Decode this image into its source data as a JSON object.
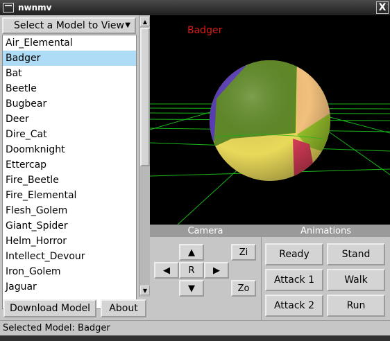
{
  "window": {
    "title": "nwnmv",
    "close_symbol": "X"
  },
  "left": {
    "select_label": "Select a Model to View",
    "models": [
      "Air_Elemental",
      "Badger",
      "Bat",
      "Beetle",
      "Bugbear",
      "Deer",
      "Dire_Cat",
      "Doomknight",
      "Ettercap",
      "Fire_Beetle",
      "Fire_Elemental",
      "Flesh_Golem",
      "Giant_Spider",
      "Helm_Horror",
      "Intellect_Devour",
      "Iron_Golem",
      "Jaguar"
    ],
    "selected_index": 1,
    "download_label": "Download Model",
    "about_label": "About"
  },
  "viewport": {
    "model_name": "Badger",
    "label_color": "#e01818",
    "grid_color": "#19b519"
  },
  "camera": {
    "header": "Camera",
    "up": "▲",
    "left": "◀",
    "reset": "R",
    "right": "▶",
    "down": "▼",
    "zoom_in": "Zi",
    "zoom_out": "Zo"
  },
  "animations": {
    "header": "Animations",
    "buttons": [
      "Ready",
      "Stand",
      "Attack 1",
      "Walk",
      "Attack 2",
      "Run"
    ]
  },
  "status": {
    "text": "Selected Model: Badger"
  }
}
